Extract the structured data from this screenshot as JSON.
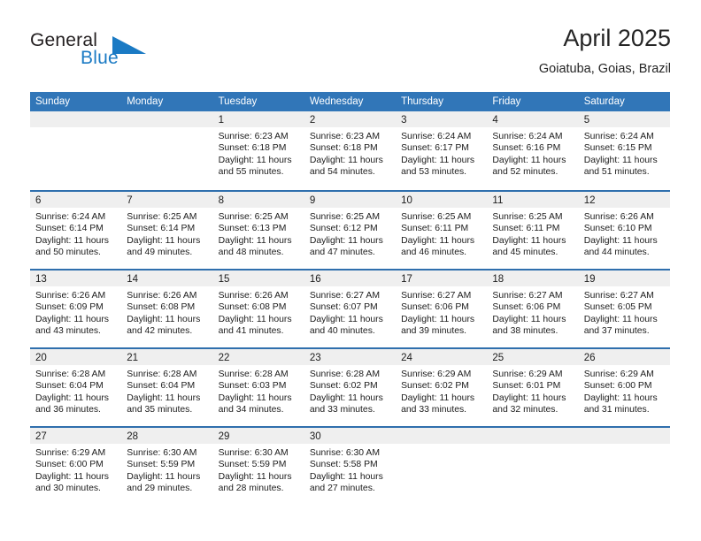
{
  "brand": {
    "word1": "General",
    "word2": "Blue",
    "triangle_color": "#1a7ac4",
    "text_color": "#231f20"
  },
  "header": {
    "title": "April 2025",
    "subtitle": "Goiatuba, Goias, Brazil"
  },
  "theme": {
    "header_blue": "#3176b8",
    "row_divider_blue": "#2f6fad",
    "daynum_band": "#efefef",
    "text": "#1c1c1c"
  },
  "calendar": {
    "day_headers": [
      "Sunday",
      "Monday",
      "Tuesday",
      "Wednesday",
      "Thursday",
      "Friday",
      "Saturday"
    ],
    "labels": {
      "sunrise": "Sunrise:",
      "sunset": "Sunset:",
      "daylight": "Daylight:"
    },
    "weeks": [
      [
        {
          "day": "",
          "empty": true
        },
        {
          "day": "",
          "empty": true
        },
        {
          "day": "1",
          "sunrise": "Sunrise: 6:23 AM",
          "sunset": "Sunset: 6:18 PM",
          "daylight1": "Daylight: 11 hours",
          "daylight2": "and 55 minutes."
        },
        {
          "day": "2",
          "sunrise": "Sunrise: 6:23 AM",
          "sunset": "Sunset: 6:18 PM",
          "daylight1": "Daylight: 11 hours",
          "daylight2": "and 54 minutes."
        },
        {
          "day": "3",
          "sunrise": "Sunrise: 6:24 AM",
          "sunset": "Sunset: 6:17 PM",
          "daylight1": "Daylight: 11 hours",
          "daylight2": "and 53 minutes."
        },
        {
          "day": "4",
          "sunrise": "Sunrise: 6:24 AM",
          "sunset": "Sunset: 6:16 PM",
          "daylight1": "Daylight: 11 hours",
          "daylight2": "and 52 minutes."
        },
        {
          "day": "5",
          "sunrise": "Sunrise: 6:24 AM",
          "sunset": "Sunset: 6:15 PM",
          "daylight1": "Daylight: 11 hours",
          "daylight2": "and 51 minutes."
        }
      ],
      [
        {
          "day": "6",
          "sunrise": "Sunrise: 6:24 AM",
          "sunset": "Sunset: 6:14 PM",
          "daylight1": "Daylight: 11 hours",
          "daylight2": "and 50 minutes."
        },
        {
          "day": "7",
          "sunrise": "Sunrise: 6:25 AM",
          "sunset": "Sunset: 6:14 PM",
          "daylight1": "Daylight: 11 hours",
          "daylight2": "and 49 minutes."
        },
        {
          "day": "8",
          "sunrise": "Sunrise: 6:25 AM",
          "sunset": "Sunset: 6:13 PM",
          "daylight1": "Daylight: 11 hours",
          "daylight2": "and 48 minutes."
        },
        {
          "day": "9",
          "sunrise": "Sunrise: 6:25 AM",
          "sunset": "Sunset: 6:12 PM",
          "daylight1": "Daylight: 11 hours",
          "daylight2": "and 47 minutes."
        },
        {
          "day": "10",
          "sunrise": "Sunrise: 6:25 AM",
          "sunset": "Sunset: 6:11 PM",
          "daylight1": "Daylight: 11 hours",
          "daylight2": "and 46 minutes."
        },
        {
          "day": "11",
          "sunrise": "Sunrise: 6:25 AM",
          "sunset": "Sunset: 6:11 PM",
          "daylight1": "Daylight: 11 hours",
          "daylight2": "and 45 minutes."
        },
        {
          "day": "12",
          "sunrise": "Sunrise: 6:26 AM",
          "sunset": "Sunset: 6:10 PM",
          "daylight1": "Daylight: 11 hours",
          "daylight2": "and 44 minutes."
        }
      ],
      [
        {
          "day": "13",
          "sunrise": "Sunrise: 6:26 AM",
          "sunset": "Sunset: 6:09 PM",
          "daylight1": "Daylight: 11 hours",
          "daylight2": "and 43 minutes."
        },
        {
          "day": "14",
          "sunrise": "Sunrise: 6:26 AM",
          "sunset": "Sunset: 6:08 PM",
          "daylight1": "Daylight: 11 hours",
          "daylight2": "and 42 minutes."
        },
        {
          "day": "15",
          "sunrise": "Sunrise: 6:26 AM",
          "sunset": "Sunset: 6:08 PM",
          "daylight1": "Daylight: 11 hours",
          "daylight2": "and 41 minutes."
        },
        {
          "day": "16",
          "sunrise": "Sunrise: 6:27 AM",
          "sunset": "Sunset: 6:07 PM",
          "daylight1": "Daylight: 11 hours",
          "daylight2": "and 40 minutes."
        },
        {
          "day": "17",
          "sunrise": "Sunrise: 6:27 AM",
          "sunset": "Sunset: 6:06 PM",
          "daylight1": "Daylight: 11 hours",
          "daylight2": "and 39 minutes."
        },
        {
          "day": "18",
          "sunrise": "Sunrise: 6:27 AM",
          "sunset": "Sunset: 6:06 PM",
          "daylight1": "Daylight: 11 hours",
          "daylight2": "and 38 minutes."
        },
        {
          "day": "19",
          "sunrise": "Sunrise: 6:27 AM",
          "sunset": "Sunset: 6:05 PM",
          "daylight1": "Daylight: 11 hours",
          "daylight2": "and 37 minutes."
        }
      ],
      [
        {
          "day": "20",
          "sunrise": "Sunrise: 6:28 AM",
          "sunset": "Sunset: 6:04 PM",
          "daylight1": "Daylight: 11 hours",
          "daylight2": "and 36 minutes."
        },
        {
          "day": "21",
          "sunrise": "Sunrise: 6:28 AM",
          "sunset": "Sunset: 6:04 PM",
          "daylight1": "Daylight: 11 hours",
          "daylight2": "and 35 minutes."
        },
        {
          "day": "22",
          "sunrise": "Sunrise: 6:28 AM",
          "sunset": "Sunset: 6:03 PM",
          "daylight1": "Daylight: 11 hours",
          "daylight2": "and 34 minutes."
        },
        {
          "day": "23",
          "sunrise": "Sunrise: 6:28 AM",
          "sunset": "Sunset: 6:02 PM",
          "daylight1": "Daylight: 11 hours",
          "daylight2": "and 33 minutes."
        },
        {
          "day": "24",
          "sunrise": "Sunrise: 6:29 AM",
          "sunset": "Sunset: 6:02 PM",
          "daylight1": "Daylight: 11 hours",
          "daylight2": "and 33 minutes."
        },
        {
          "day": "25",
          "sunrise": "Sunrise: 6:29 AM",
          "sunset": "Sunset: 6:01 PM",
          "daylight1": "Daylight: 11 hours",
          "daylight2": "and 32 minutes."
        },
        {
          "day": "26",
          "sunrise": "Sunrise: 6:29 AM",
          "sunset": "Sunset: 6:00 PM",
          "daylight1": "Daylight: 11 hours",
          "daylight2": "and 31 minutes."
        }
      ],
      [
        {
          "day": "27",
          "sunrise": "Sunrise: 6:29 AM",
          "sunset": "Sunset: 6:00 PM",
          "daylight1": "Daylight: 11 hours",
          "daylight2": "and 30 minutes."
        },
        {
          "day": "28",
          "sunrise": "Sunrise: 6:30 AM",
          "sunset": "Sunset: 5:59 PM",
          "daylight1": "Daylight: 11 hours",
          "daylight2": "and 29 minutes."
        },
        {
          "day": "29",
          "sunrise": "Sunrise: 6:30 AM",
          "sunset": "Sunset: 5:59 PM",
          "daylight1": "Daylight: 11 hours",
          "daylight2": "and 28 minutes."
        },
        {
          "day": "30",
          "sunrise": "Sunrise: 6:30 AM",
          "sunset": "Sunset: 5:58 PM",
          "daylight1": "Daylight: 11 hours",
          "daylight2": "and 27 minutes."
        },
        {
          "day": "",
          "empty": true
        },
        {
          "day": "",
          "empty": true
        },
        {
          "day": "",
          "empty": true
        }
      ]
    ]
  }
}
